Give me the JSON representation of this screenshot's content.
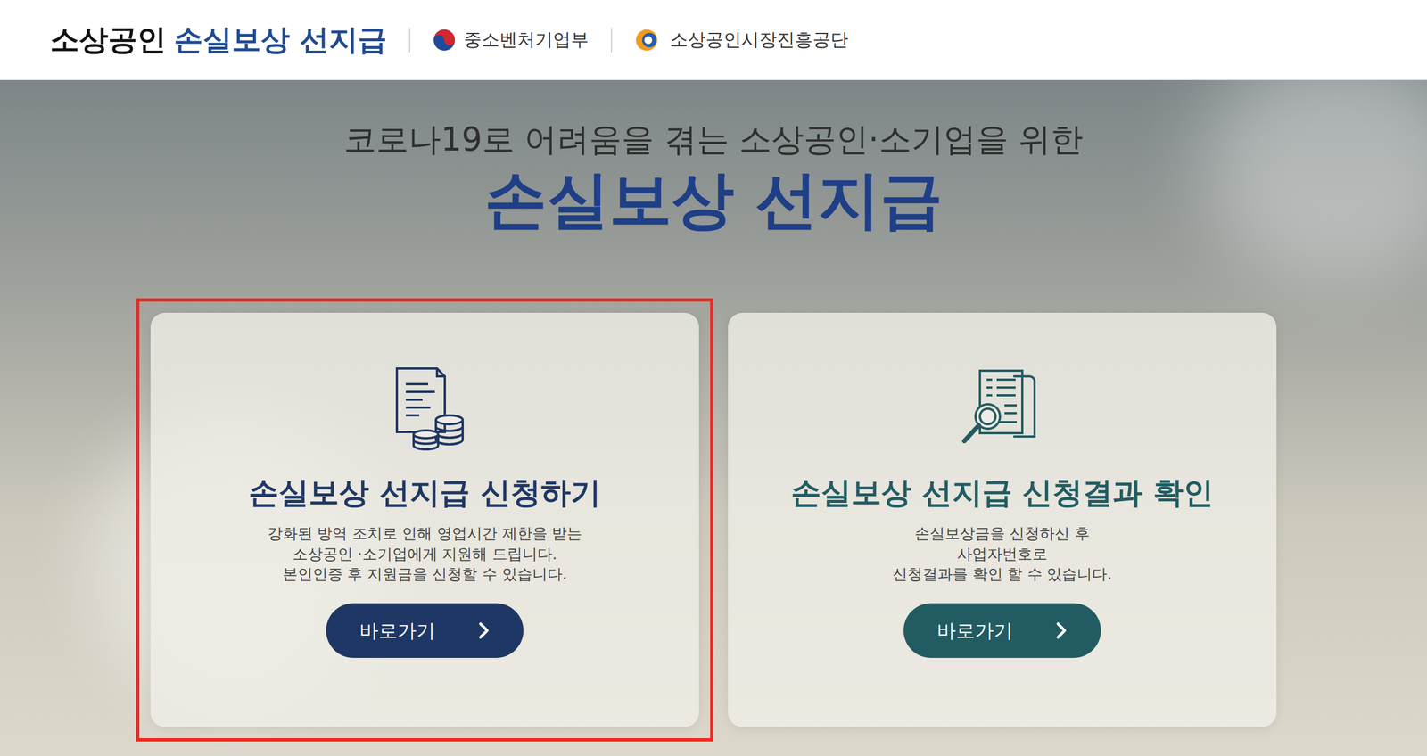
{
  "header": {
    "logo": {
      "prefix": "소상공인",
      "highlight": "손실보상 선지급"
    },
    "agencies": [
      "중소벤처기업부",
      "소상공인시장진흥공단"
    ]
  },
  "hero": {
    "subtitle": "코로나19로 어려움을 겪는 소상공인·소기업을 위한",
    "title": "손실보상 선지급"
  },
  "cards": [
    {
      "kind": "apply",
      "highlighted": true,
      "color": "#1f3764",
      "title": "손실보상 선지급 신청하기",
      "description": [
        "강화된 방역 조치로 인해 영업시간 제한을 받는",
        "소상공인 ·소기업에게 지원해 드립니다.",
        "본인인증 후 지원금을 신청할 수 있습니다."
      ],
      "button": "바로가기"
    },
    {
      "kind": "result",
      "highlighted": false,
      "color": "#225c62",
      "title": "손실보상 선지급 신청결과 확인",
      "description": [
        "손실보상금을 신청하신 후",
        "사업자번호로",
        "신청결과를 확인 할 수 있습니다."
      ],
      "button": "바로가기"
    }
  ]
}
